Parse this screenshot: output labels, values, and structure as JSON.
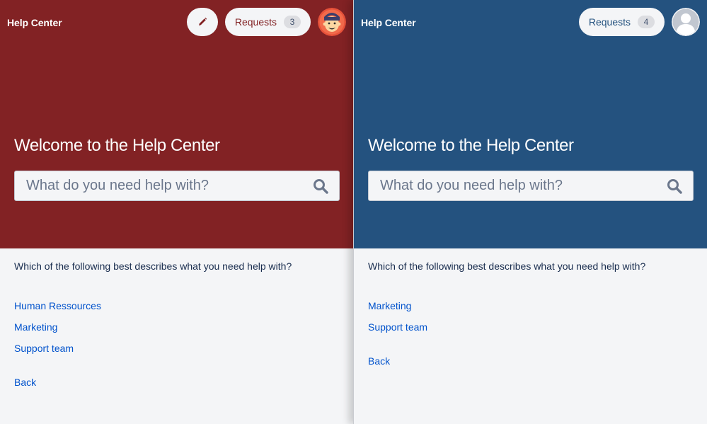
{
  "left": {
    "brand": "Help Center",
    "requests_label": "Requests",
    "requests_count": "3",
    "welcome": "Welcome to the Help Center",
    "search_placeholder": "What do you need help with?",
    "question": "Which of the following best describes what you need help with?",
    "links": [
      "Human Ressources",
      "Marketing",
      "Support team"
    ],
    "back": "Back",
    "hero_color": "#822224"
  },
  "right": {
    "brand": "Help Center",
    "requests_label": "Requests",
    "requests_count": "4",
    "welcome": "Welcome to the Help Center",
    "search_placeholder": "What do you need help with?",
    "question": "Which of the following best describes what you need help with?",
    "links": [
      "Marketing",
      "Support team"
    ],
    "back": "Back",
    "hero_color": "#24527f"
  },
  "icons": {
    "edit": "pencil-icon",
    "search": "search-icon",
    "avatar_left": "cartoon-avatar-icon",
    "avatar_right": "default-user-avatar-icon"
  },
  "colors": {
    "link": "#0052cc",
    "page_bg": "#f4f5f7"
  }
}
